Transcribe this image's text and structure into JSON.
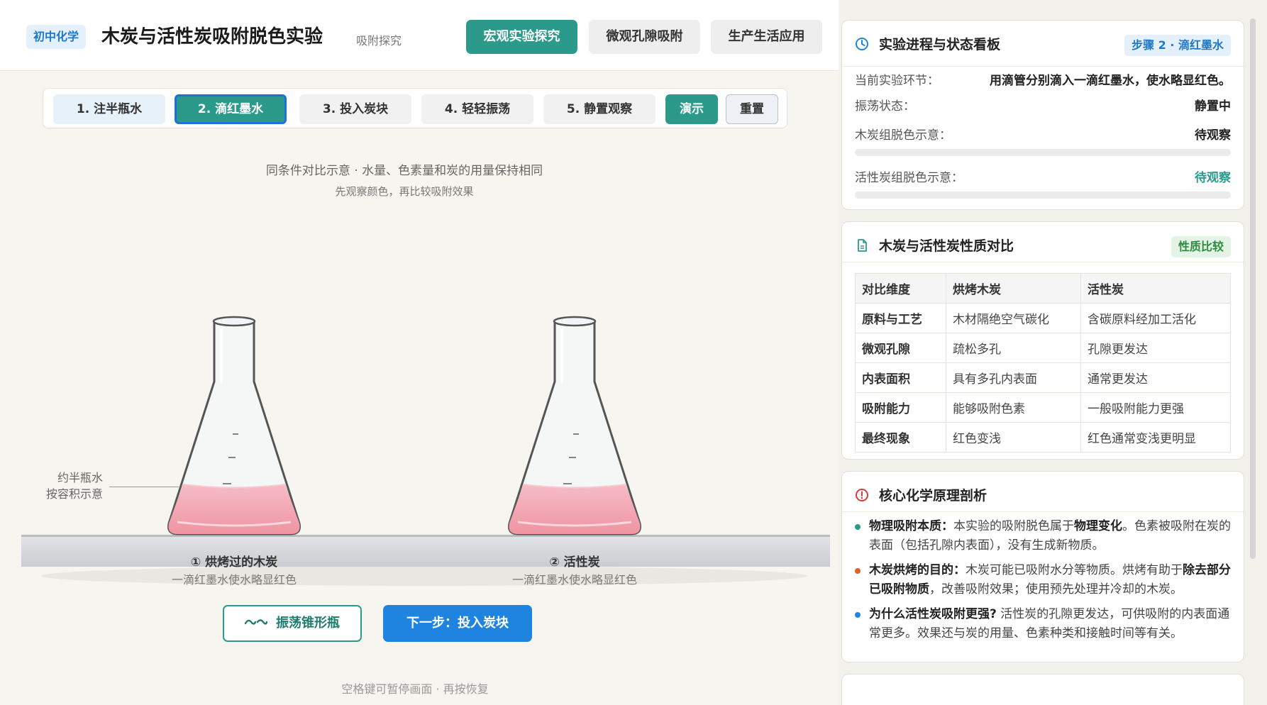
{
  "header": {
    "subject_badge": "初中化学",
    "title": "木炭与活性炭吸附脱色实验",
    "subtitle": "吸附探究",
    "mode_tabs": [
      {
        "label": "宏观实验探究",
        "active": true
      },
      {
        "label": "微观孔隙吸附",
        "active": false
      },
      {
        "label": "生产生活应用",
        "active": false
      }
    ]
  },
  "steps": {
    "items": [
      {
        "label": "1. 注半瓶水",
        "state": "done"
      },
      {
        "label": "2. 滴红墨水",
        "state": "active"
      },
      {
        "label": "3. 投入炭块",
        "state": "pending"
      },
      {
        "label": "4. 轻轻振荡",
        "state": "pending"
      },
      {
        "label": "5. 静置观察",
        "state": "pending"
      }
    ],
    "play_label": "演示",
    "reset_label": "重置"
  },
  "stage": {
    "caption": "同条件对比示意 · 水量、色素量和炭的用量保持相同",
    "caption_sub": "先观察颜色，再比较吸附效果",
    "water_note_line1": "约半瓶水",
    "water_note_line2": "按容积示意",
    "flasks": [
      {
        "title": "① 烘烤过的木炭",
        "desc": "一滴红墨水使水略显红色"
      },
      {
        "title": "② 活性炭",
        "desc": "一滴红墨水使水略显红色"
      }
    ],
    "liquid_color": "#f2a7b2"
  },
  "actions": {
    "shake_label": "振荡锥形瓶",
    "next_label": "下一步：投入炭块"
  },
  "footer_hint": "空格键可暂停画面 · 再按恢复",
  "status_card": {
    "title": "实验进程与状态看板",
    "tag": "步骤 2 · 滴红墨水",
    "rows": {
      "stage_key": "当前实验环节：",
      "stage_val": "用滴管分别滴入一滴红墨水，使水略显红色。",
      "shake_key": "振荡状态：",
      "shake_val": "静置中",
      "charcoal_key": "木炭组脱色示意：",
      "charcoal_val": "待观察",
      "activated_key": "活性炭组脱色示意：",
      "activated_val": "待观察"
    },
    "charcoal_progress": 0,
    "activated_progress": 0
  },
  "compare_card": {
    "title": "木炭与活性炭性质对比",
    "tag": "性质比较",
    "headers": [
      "对比维度",
      "烘烤木炭",
      "活性炭"
    ],
    "rows": [
      [
        "原料与工艺",
        "木材隔绝空气碳化",
        "含碳原料经加工活化"
      ],
      [
        "微观孔隙",
        "疏松多孔",
        "孔隙更发达"
      ],
      [
        "内表面积",
        "具有多孔内表面",
        "通常更发达"
      ],
      [
        "吸附能力",
        "能够吸附色素",
        "一般吸附能力更强"
      ],
      [
        "最终现象",
        "红色变浅",
        "红色通常变浅更明显"
      ]
    ]
  },
  "principle_card": {
    "title": "核心化学原理剖析",
    "items": [
      {
        "color": "#2b9a8a",
        "lead": "物理吸附本质：",
        "text_a": "本实验的吸附脱色属于",
        "bold_a": "物理变化",
        "text_b": "。色素被吸附在炭的表面（包括孔隙内表面），没有生成新物质。"
      },
      {
        "color": "#e0622a",
        "lead": "木炭烘烤的目的：",
        "text_a": "木炭可能已吸附水分等物质。烘烤有助于",
        "bold_a": "除去部分已吸附物质",
        "text_b": "，改善吸附效果；使用预先处理并冷却的木炭。"
      },
      {
        "color": "#1f84e0",
        "lead": "为什么活性炭吸附更强?",
        "text_a": " 活性炭的孔隙更发达，可供吸附的内表面通常更多。效果还与炭的用量、色素种类和接触时间等有关。",
        "bold_a": "",
        "text_b": ""
      }
    ]
  }
}
